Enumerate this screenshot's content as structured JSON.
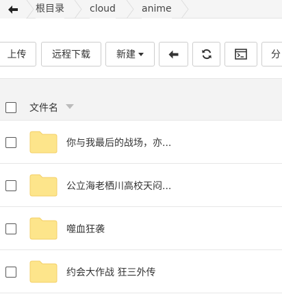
{
  "breadcrumb": {
    "items": [
      {
        "label": "根目录"
      },
      {
        "label": "cloud"
      },
      {
        "label": "anime"
      }
    ]
  },
  "toolbar": {
    "upload_label": "上传",
    "remote_download_label": "远程下载",
    "new_label": "新建",
    "share_label_partial": "分"
  },
  "table": {
    "header_label": "文件名"
  },
  "files": [
    {
      "name": "你与我最后的战场，亦..."
    },
    {
      "name": "公立海老栖川高校天闷..."
    },
    {
      "name": "噬血狂袭"
    },
    {
      "name": "约会大作战 狂三外传"
    }
  ],
  "colors": {
    "folder_fill": "#fde58b",
    "folder_edge": "#f3cf67",
    "border": "#cccccc"
  }
}
